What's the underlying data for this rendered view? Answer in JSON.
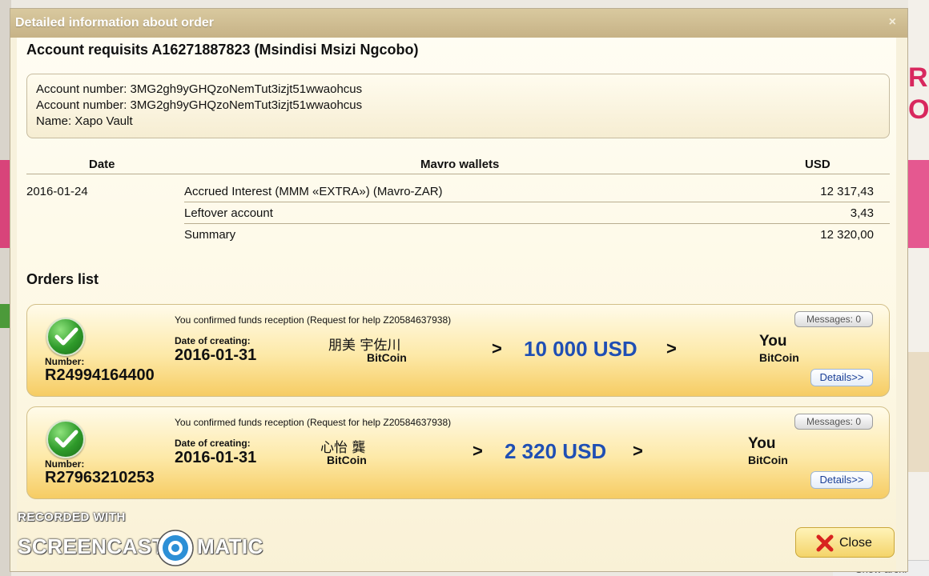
{
  "dialog": {
    "title": "Detailed information about order",
    "close_icon": "close-icon",
    "close_glyph": "×"
  },
  "account": {
    "title": "Account requisits A16271887823 (Msindisi Msizi Ngcobo)",
    "lines": [
      "Account number: 3MG2gh9yGHQzoNemTut3izjt51wwaohcus",
      "Account number: 3MG2gh9yGHQzoNemTut3izjt51wwaohcus",
      "Name: Xapo Vault"
    ]
  },
  "wallets": {
    "headers": {
      "date": "Date",
      "wallets": "Mavro wallets",
      "usd": "USD"
    },
    "rows": [
      {
        "date": "2016-01-24",
        "label": "Accrued Interest (MMM «EXTRA») (Mavro-ZAR)",
        "usd": "12 317,43"
      },
      {
        "date": "",
        "label": "Leftover account",
        "usd": "3,43"
      },
      {
        "date": "",
        "label": "Summary",
        "usd": "12 320,00"
      }
    ]
  },
  "orders": {
    "title": "Orders list",
    "items": [
      {
        "confirm_text": "You confirmed funds reception (Request for help Z20584637938)",
        "messages_label": "Messages: 0",
        "number_label": "Number:",
        "number": "R24994164400",
        "date_label": "Date of creating:",
        "date": "2016-01-31",
        "sender": "朋美 宇佐川",
        "sender_coin": "BitCoin",
        "arrow": ">",
        "amount": "10 000 USD",
        "receiver": "You",
        "receiver_coin": "BitCoin",
        "details_label": "Details>>"
      },
      {
        "confirm_text": "You confirmed funds reception (Request for help Z20584637938)",
        "messages_label": "Messages: 0",
        "number_label": "Number:",
        "number": "R27963210253",
        "date_label": "Date of creating:",
        "date": "2016-01-31",
        "sender": "心怡 龔",
        "sender_coin": "BitCoin",
        "arrow": ">",
        "amount": "2 320 USD",
        "receiver": "You",
        "receiver_coin": "BitCoin",
        "details_label": "Details>>"
      }
    ]
  },
  "footer": {
    "close_label": "Close"
  },
  "watermark": {
    "line1": "RECORDED WITH",
    "word1": "SCREENCAST",
    "word2": "MATIC"
  },
  "background": {
    "letter1": "R",
    "letter2": "O",
    "bottom_link": "Show archi"
  },
  "colors": {
    "amount": "#1f4fb4",
    "title_bar": "#c9b68a",
    "accent_yellow": "#f6cc63",
    "check_green": "#2e9a2a"
  },
  "icons": {
    "check": "check-icon",
    "close_button": "red-x-icon",
    "watermark_logo": "screencast-logo-icon"
  }
}
